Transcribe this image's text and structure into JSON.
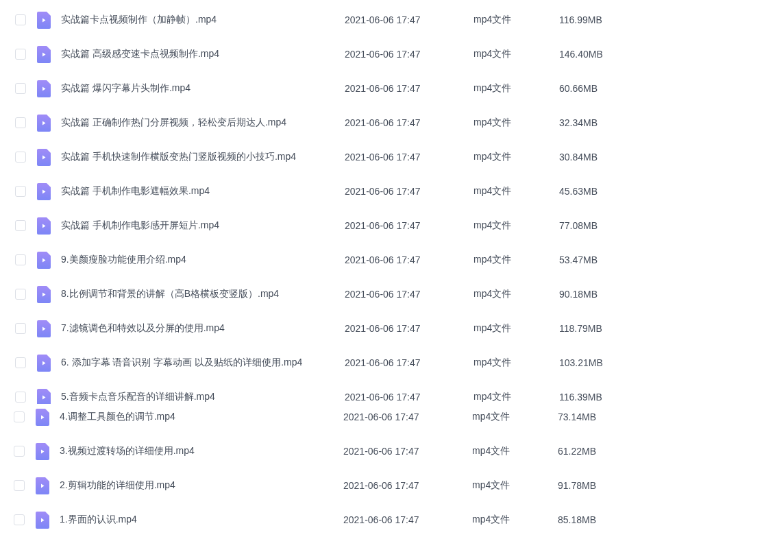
{
  "panels": [
    {
      "rows": [
        {
          "name": "实战篇卡点视频制作（加静帧）.mp4",
          "date": "2021-06-06 17:47",
          "type": "mp4文件",
          "size": "116.99MB",
          "checked": false
        },
        {
          "name": "实战篇 高级感变速卡点视频制作.mp4",
          "date": "2021-06-06 17:47",
          "type": "mp4文件",
          "size": "146.40MB",
          "checked": false
        },
        {
          "name": "实战篇 爆闪字幕片头制作.mp4",
          "date": "2021-06-06 17:47",
          "type": "mp4文件",
          "size": "60.66MB",
          "checked": false
        },
        {
          "name": "实战篇 正确制作热门分屏视频，轻松变后期达人.mp4",
          "date": "2021-06-06 17:47",
          "type": "mp4文件",
          "size": "32.34MB",
          "checked": false
        },
        {
          "name": "实战篇 手机快速制作横版变热门竖版视频的小技巧.mp4",
          "date": "2021-06-06 17:47",
          "type": "mp4文件",
          "size": "30.84MB",
          "checked": false
        },
        {
          "name": "实战篇 手机制作电影遮幅效果.mp4",
          "date": "2021-06-06 17:47",
          "type": "mp4文件",
          "size": "45.63MB",
          "checked": false
        },
        {
          "name": "实战篇 手机制作电影感开屏短片.mp4",
          "date": "2021-06-06 17:47",
          "type": "mp4文件",
          "size": "77.08MB",
          "checked": false
        },
        {
          "name": "9.美颜瘦脸功能使用介绍.mp4",
          "date": "2021-06-06 17:47",
          "type": "mp4文件",
          "size": "53.47MB",
          "checked": false
        },
        {
          "name": "8.比例调节和背景的讲解（高B格横板变竖版）.mp4",
          "date": "2021-06-06 17:47",
          "type": "mp4文件",
          "size": "90.18MB",
          "checked": false
        },
        {
          "name": "7.滤镜调色和特效以及分屏的使用.mp4",
          "date": "2021-06-06 17:47",
          "type": "mp4文件",
          "size": "118.79MB",
          "checked": false
        },
        {
          "name": "6. 添加字幕 语音识别 字幕动画 以及贴纸的详细使用.mp4",
          "date": "2021-06-06 17:47",
          "type": "mp4文件",
          "size": "103.21MB",
          "checked": false
        },
        {
          "name": "5.音频卡点音乐配音的详细讲解.mp4",
          "date": "2021-06-06 17:47",
          "type": "mp4文件",
          "size": "116.39MB",
          "checked": false
        }
      ]
    },
    {
      "rows": [
        {
          "name": "4.调整工具颜色的调节.mp4",
          "date": "2021-06-06 17:47",
          "type": "mp4文件",
          "size": "73.14MB",
          "checked": false
        },
        {
          "name": "3.视频过渡转场的详细使用.mp4",
          "date": "2021-06-06 17:47",
          "type": "mp4文件",
          "size": "61.22MB",
          "checked": false
        },
        {
          "name": "2.剪辑功能的详细使用.mp4",
          "date": "2021-06-06 17:47",
          "type": "mp4文件",
          "size": "91.78MB",
          "checked": false
        },
        {
          "name": "1.界面的认识.mp4",
          "date": "2021-06-06 17:47",
          "type": "mp4文件",
          "size": "85.18MB",
          "checked": false
        }
      ]
    }
  ]
}
